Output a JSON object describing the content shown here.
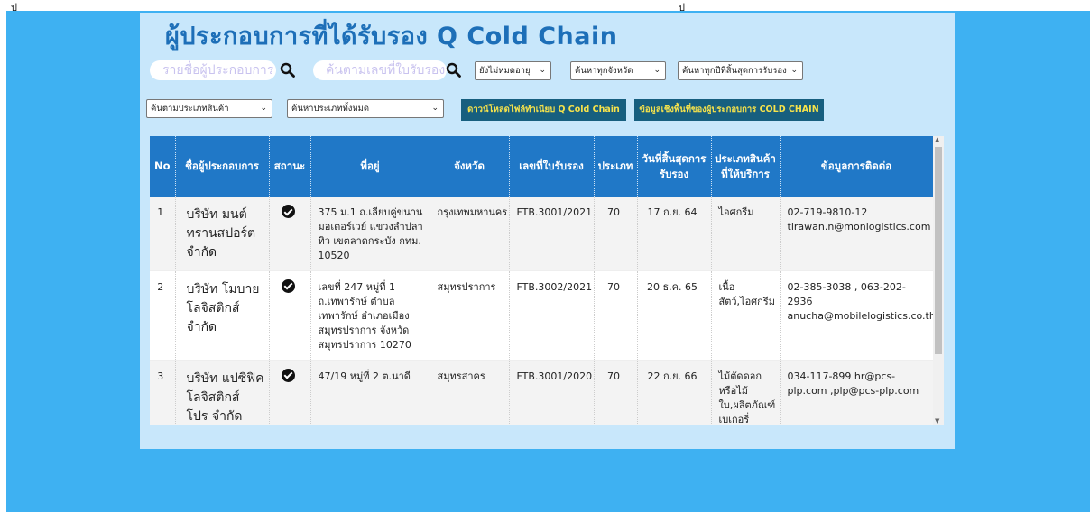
{
  "title": "ผู้ประกอบการที่ได้รับรอง Q Cold Chain",
  "top_marks": [
    "ป",
    "ป"
  ],
  "search": {
    "name_placeholder": "รายชื่อผู้ประกอบการ",
    "license_placeholder": "ค้นตามเลขที่ใบรับรอง"
  },
  "filters": {
    "expiry": "ยังไม่หมดอายุ",
    "province": "ค้นหาทุกจังหวัด",
    "year": "ค้นหาทุกปีที่สิ้นสุดการรับรอง",
    "product_type": "ค้นตามประเภทสินค้า",
    "all_types": "ค้นหาประเภททั้งหมด"
  },
  "buttons": {
    "download": "ดาวน์โหลดไฟล์ทำเนียบ Q Cold Chain",
    "info": "ข้อมูลเชิงพื้นที่ของผู้ประกอบการ COLD CHAIN"
  },
  "table": {
    "headers": [
      "No",
      "ชื่อผู้ประกอบการ",
      "สถานะ",
      "ที่อยู่",
      "จังหวัด",
      "เลขที่ใบรับรอง",
      "ประเภท",
      "วันที่สิ้นสุดการรับรอง",
      "ประเภทสินค้าที่ให้บริการ",
      "ข้อมูลการติดต่อ"
    ],
    "rows": [
      {
        "no": "1",
        "name": "บริษัท มนต์ ทรานสปอร์ต จำกัด",
        "address": "375 ม.1 ถ.เลียบคู่ขนาน มอเตอร์เวย์ แขวงลำปลาทิว เขตลาดกระบัง กทม. 10520",
        "province": "กรุงเทพมหานคร",
        "license": "FTB.3001/2021",
        "type": "70",
        "expiry": "17 ก.ย. 64",
        "product": "ไอศกรีม",
        "contact": "02-719-9810-12 tirawan.n@monlogistics.com"
      },
      {
        "no": "2",
        "name": "บริษัท โมบาย โลจิสติกส์ จำกัด",
        "address": "เลขที่ 247 หมู่ที่ 1 ถ.เทพารักษ์ ตำบลเทพารักษ์ อำเภอเมืองสมุทรปราการ จังหวัดสมุทรปราการ 10270",
        "province": "สมุทรปราการ",
        "license": "FTB.3002/2021",
        "type": "70",
        "expiry": "20 ธ.ค. 65",
        "product": "เนื้อสัตว์,ไอศกรีม",
        "contact": "02-385-3038 , 063-202-2936 anucha@mobilelogistics.co.th"
      },
      {
        "no": "3",
        "name": "บริษัท แปซิฟิค โลจิสติกส์ โปร จำกัด",
        "address": "47/19 หมู่ที่ 2 ต.นาดี",
        "province": "สมุทรสาคร",
        "license": "FTB.3001/2020",
        "type": "70",
        "expiry": "22 ก.ย. 66",
        "product": "ไม้ตัดดอก หรือไม้ใบ,ผลิตภัณฑ์เบเกอรี่",
        "contact": "034-117-899 hr@pcs-plp.com ,plp@pcs-plp.com"
      }
    ]
  },
  "colors": {
    "background": "#3eb1f2",
    "panel": "#c8e7fb",
    "title": "#1d6fb8",
    "header": "#2078c7",
    "button_bg": "#175f7f",
    "button_text": "#f7e34b"
  }
}
